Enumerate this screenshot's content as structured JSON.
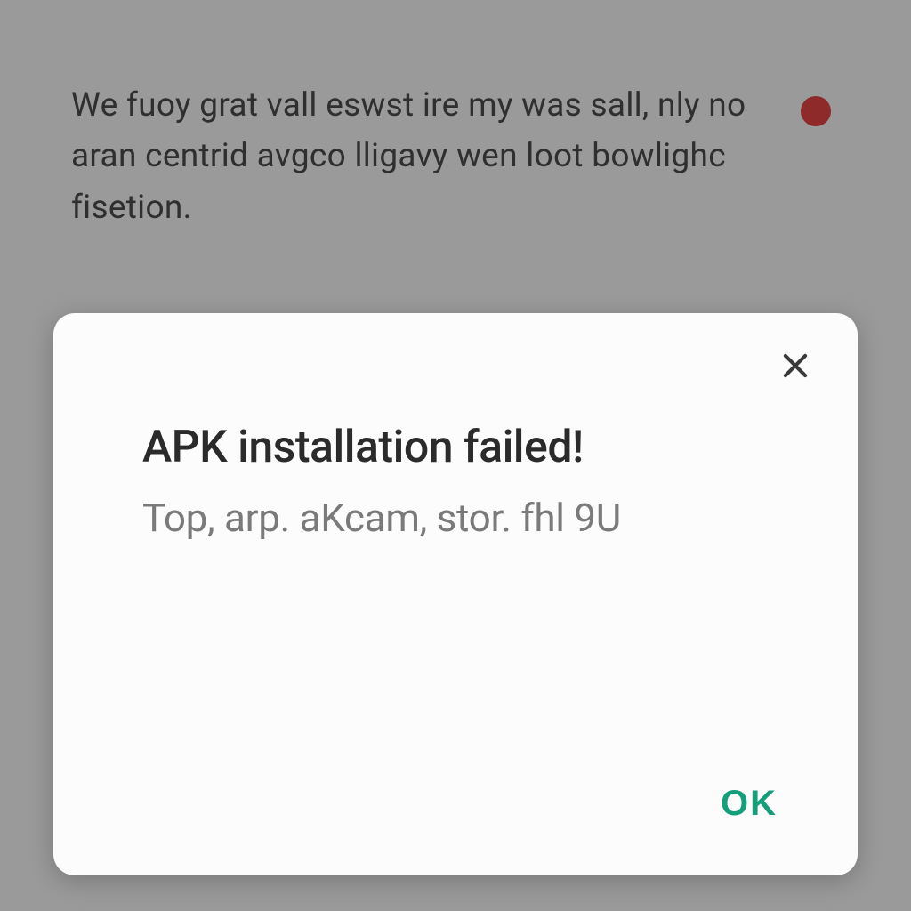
{
  "background": {
    "text": "We fuoy grat vall eswst ire my was sall, nly no aran centrid avgco lligavy wen loot bowlighc fisetion."
  },
  "dialog": {
    "title": "APK installation failed!",
    "message": "Top, arp. aKcam, stor. fhl 9U",
    "ok_label": "OK"
  },
  "colors": {
    "accent": "#149e7a",
    "status_dot": "#8f2a2a"
  }
}
